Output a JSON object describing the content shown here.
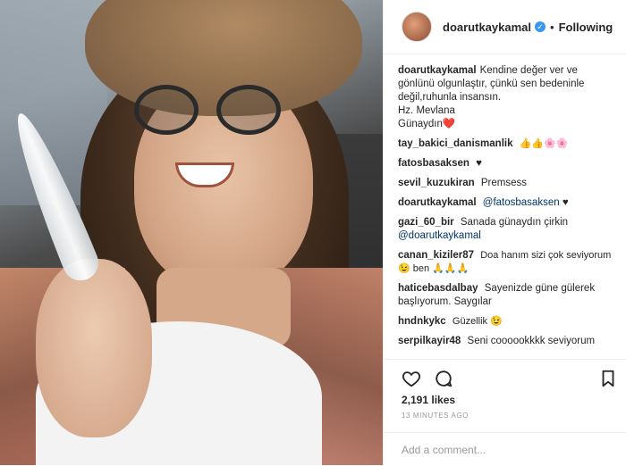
{
  "header": {
    "username": "doarutkaykamal",
    "verified_icon": "verified-badge-icon",
    "separator": "•",
    "follow_label": "Following"
  },
  "caption": {
    "username": "doarutkaykamal",
    "line1": "Kendine değer ver ve gönlünü olgunlaştır, çünkü sen bedeninle değil,ruhunla insansın.",
    "line2": "Hz. Mevlana",
    "line3": "Günaydın❤️"
  },
  "comments": [
    {
      "user": "tay_bakici_danismanlik",
      "text": "👍👍🌸🌸"
    },
    {
      "user": "fatosbasaksen",
      "text": "♥"
    },
    {
      "user": "sevil_kuzukiran",
      "text": "Premsess"
    },
    {
      "user": "doarutkaykamal",
      "mention": "@fatosbasaksen",
      "text": "♥"
    },
    {
      "user": "gazi_60_bir",
      "text": "Sanada günaydın çirkin",
      "mention": "@doarutkaykamal"
    },
    {
      "user": "canan_kiziler87",
      "text": "Doa hanım sizi çok seviyorum 😉 ben 🙏🙏🙏"
    },
    {
      "user": "haticebasdalbay",
      "text": "Sayenizde güne gülerek başlıyorum. Saygılar"
    },
    {
      "user": "hndnkykc",
      "text": "Güzellik 😉"
    },
    {
      "user": "serpilkayir48",
      "text": "Seni coooookkkk seviyorum"
    }
  ],
  "actions": {
    "like_icon": "heart-icon",
    "comment_icon": "comment-bubble-icon",
    "save_icon": "bookmark-icon"
  },
  "likes": "2,191 likes",
  "time_ago": "13 MINUTES AGO",
  "comment_input": {
    "placeholder": "Add a comment..."
  }
}
